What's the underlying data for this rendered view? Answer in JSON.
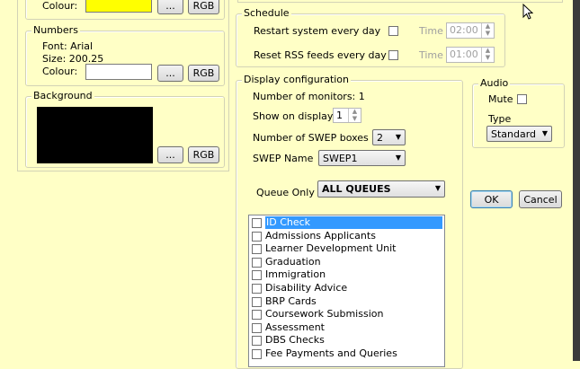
{
  "colours_panel": {
    "colour_label": "Colour:",
    "colour_swatch": "#ffff00",
    "browse_label": "...",
    "rgb_label": "RGB"
  },
  "numbers": {
    "title": "Numbers",
    "font_line": "Font: Arial",
    "size_line": "Size: 200.25",
    "colour_label": "Colour:",
    "colour_swatch": "#ffffff",
    "browse_label": "...",
    "rgb_label": "RGB"
  },
  "background": {
    "title": "Background",
    "colour_swatch": "#000000",
    "browse_label": "...",
    "rgb_label": "RGB"
  },
  "schedule": {
    "title": "Schedule",
    "restart_label": "Restart system every day",
    "restart_time_label": "Time",
    "restart_time_value": "02:00",
    "reset_label": "Reset RSS feeds every day",
    "reset_time_label": "Time",
    "reset_time_value": "01:00"
  },
  "display": {
    "title": "Display configuration",
    "monitors_line": "Number of monitors: 1",
    "show_on_display_label": "Show on display",
    "show_on_display_value": "1",
    "swep_boxes_label": "Number of SWEP boxes",
    "swep_boxes_value": "2",
    "swep_name_label": "SWEP Name",
    "swep_name_value": "SWEP1",
    "queue_only_label": "Queue Only",
    "queue_only_value": "ALL QUEUES",
    "queues": [
      "ID Check",
      "Admissions Applicants",
      "Learner Development Unit",
      "Graduation",
      "Immigration",
      "Disability Advice",
      "BRP Cards",
      "Coursework Submission",
      "Assessment",
      "DBS Checks",
      "Fee Payments and Queries"
    ]
  },
  "audio": {
    "title": "Audio",
    "mute_label": "Mute",
    "type_label": "Type",
    "type_value": "Standard"
  },
  "dialog": {
    "ok_label": "OK",
    "cancel_label": "Cancel"
  }
}
